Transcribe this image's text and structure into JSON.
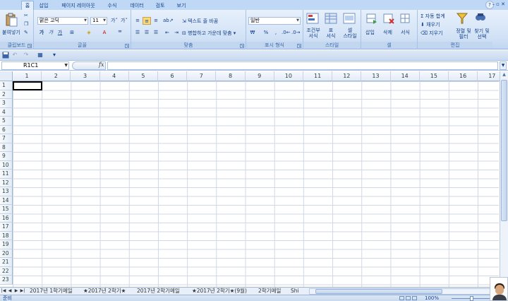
{
  "tabs": [
    {
      "label": "홈",
      "active": true
    },
    {
      "label": "삽입"
    },
    {
      "label": "페이지 레이아웃"
    },
    {
      "label": "수식"
    },
    {
      "label": "데이터"
    },
    {
      "label": "검토"
    },
    {
      "label": "보기"
    }
  ],
  "ribbon": {
    "clipboard": {
      "paste": "붙여넣기",
      "label": "클립보드"
    },
    "font": {
      "name": "맑은 고딕",
      "size": "11",
      "label": "글꼴",
      "bold": "가",
      "italic": "가",
      "underline": "가"
    },
    "alignment": {
      "wrap": "텍스트 줄 바꿈",
      "merge": "병합하고 가운데 맞춤",
      "label": "맞춤"
    },
    "number": {
      "format": "일반",
      "currency": "₩",
      "percent": "%",
      "comma": ",",
      "label": "표시 형식"
    },
    "styles": {
      "conditional_line1": "조건부",
      "conditional_line2": "서식",
      "table_line1": "표",
      "table_line2": "서식",
      "cell_line1": "셀",
      "cell_line2": "스타일",
      "label": "스타일"
    },
    "cells": {
      "insert": "삽입",
      "delete": "삭제",
      "format": "서식",
      "label": "셀"
    },
    "editing": {
      "autosum": "Σ 자동 합계",
      "fill": "채우기",
      "clear": "지우기",
      "sort_line1": "정렬 및",
      "sort_line2": "필터",
      "find_line1": "찾기 및",
      "find_line2": "선택",
      "label": "편집"
    }
  },
  "formula_bar": {
    "name_box": "R1C1",
    "fx": "fx",
    "value": ""
  },
  "columns": [
    "1",
    "2",
    "3",
    "4",
    "5",
    "6",
    "7",
    "8",
    "9",
    "10",
    "11",
    "12",
    "13",
    "14",
    "15",
    "16",
    "17"
  ],
  "rows": [
    "1",
    "2",
    "3",
    "4",
    "5",
    "6",
    "7",
    "8",
    "9",
    "10",
    "11",
    "12",
    "13",
    "14",
    "15",
    "16",
    "17",
    "18",
    "19",
    "20",
    "21",
    "22",
    "23"
  ],
  "sheets": [
    "2017년 1학기메일",
    "★2017년 2학기★",
    "2017년 2학기메일",
    "★2017년 2학기★(9월)",
    "2학기메일",
    "Shi"
  ],
  "status": {
    "ready": "준비",
    "zoom": "100%"
  },
  "colors": {
    "accent": "#15428b",
    "ribbon_bg": "#d2e2f6",
    "grid": "#d0d7e5",
    "selection_border": "#000000"
  }
}
